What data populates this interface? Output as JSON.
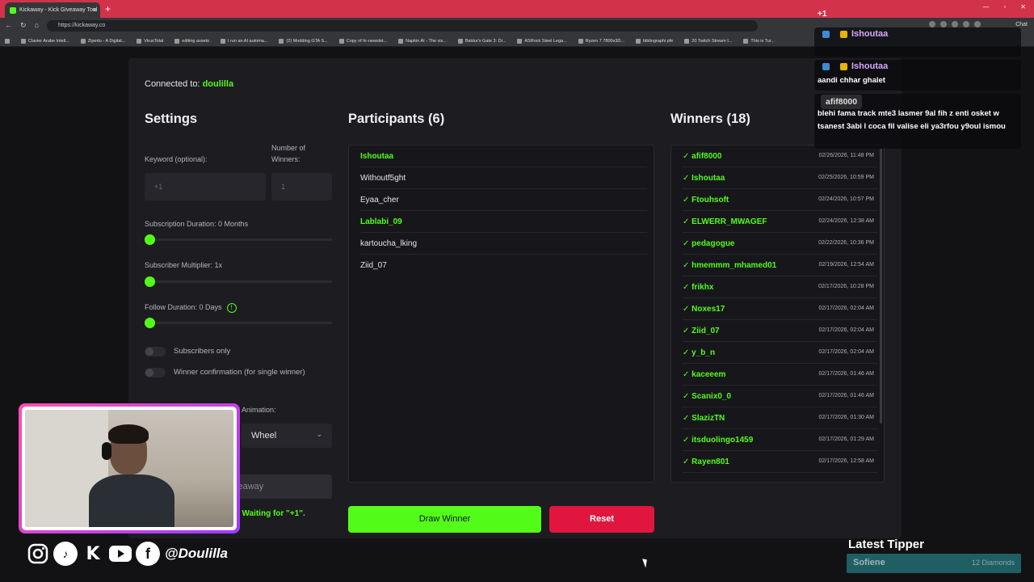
{
  "browser": {
    "tab_title": "Kickaway - Kick Giveaway Tool",
    "url": "https://kickaway.co",
    "chat_label": "Chat",
    "bookmarks": [
      "Clavier Arabe Intell...",
      "Ziperto - A Digital...",
      "VirusTotal",
      "editing assets",
      "I run an AI automa...",
      "(2) Modding GTA S...",
      "Copy of hr-newslet...",
      "Napkin AI - The vis...",
      "Baldur's Gate 3: Di...",
      "ASRock Steel Lega...",
      "Ryzen 7 7800x3D...",
      "bibliographi pfe",
      "20 Twitch Stream I...",
      "This is Tur..."
    ]
  },
  "app": {
    "connected_prefix": "Connected to:",
    "channel": "doulilla",
    "settings": {
      "title": "Settings",
      "keyword_label": "Keyword (optional):",
      "keyword_placeholder": "+1",
      "winners_label": "Number of Winners:",
      "winners_placeholder": "1",
      "sub_duration_label": "Subscription Duration: 0 Months",
      "sub_multiplier_label": "Subscriber Multiplier: 1x",
      "follow_duration_label": "Follow Duration: 0 Days",
      "info_glyph": "!",
      "subscribers_only_label": "Subscribers only",
      "winner_confirm_label": "Winner confirmation (for single winner)",
      "animation_label": "Animation:",
      "animation_value": "Wheel",
      "start_button_partial": "veaway",
      "status_text": "t! Waiting for \"+1\"."
    },
    "participants": {
      "title": "Participants (6)",
      "items": [
        {
          "name": "Ishoutaa",
          "highlight": true
        },
        {
          "name": "Withoutf5ght",
          "highlight": false
        },
        {
          "name": "Eyaa_cher",
          "highlight": false
        },
        {
          "name": "Lablabi_09",
          "highlight": true
        },
        {
          "name": "kartoucha_lking",
          "highlight": false
        },
        {
          "name": "Ziid_07",
          "highlight": false
        }
      ]
    },
    "winners": {
      "title": "Winners (18)",
      "items": [
        {
          "name": "✓ afif8000",
          "date": "02/26/2026, 11:48 PM"
        },
        {
          "name": "✓ Ishoutaa",
          "date": "02/25/2026, 10:59 PM"
        },
        {
          "name": "✓ Ftouhsoft",
          "date": "02/24/2026, 10:57 PM"
        },
        {
          "name": "✓ ELWERR_MWAGEF",
          "date": "02/24/2026, 12:38 AM"
        },
        {
          "name": "✓ pedagogue",
          "date": "02/22/2026, 10:36 PM"
        },
        {
          "name": "✓ hmemmm_mhamed01",
          "date": "02/19/2026, 12:54 AM"
        },
        {
          "name": "✓ frikhx",
          "date": "02/17/2026, 10:28 PM"
        },
        {
          "name": "✓ Noxes17",
          "date": "02/17/2026, 02:04 AM"
        },
        {
          "name": "✓ Ziid_07",
          "date": "02/17/2026, 02:04 AM"
        },
        {
          "name": "✓ y_b_n",
          "date": "02/17/2026, 02:04 AM"
        },
        {
          "name": "✓ kaceeem",
          "date": "02/17/2026, 01:46 AM"
        },
        {
          "name": "✓ Scanix0_0",
          "date": "02/17/2026, 01:46 AM"
        },
        {
          "name": "✓ SlazizTN",
          "date": "02/17/2026, 01:30 AM"
        },
        {
          "name": "✓ itsduolingo1459",
          "date": "02/17/2026, 01:29 AM"
        },
        {
          "name": "✓ Rayen801",
          "date": "02/17/2026, 12:58 AM"
        }
      ]
    },
    "draw_button": "Draw Winner",
    "reset_button": "Reset"
  },
  "chat": {
    "plus_text": "+1",
    "messages": [
      {
        "user": "Ishoutaa",
        "text": ""
      },
      {
        "user": "Ishoutaa",
        "text": "aandi chhar ghalet"
      },
      {
        "user": "afif8000",
        "text": "blehi fama track mte3 lasmer 9al fih z enti osket w tsanest 3abi l coca fil valise eli ya3rfou y9oul ismou"
      }
    ]
  },
  "overlay": {
    "social_handle": "@Doulilla",
    "latest_tipper_label": "Latest Tipper",
    "tipper_name": "Sofiene",
    "tipper_amount": "12 Diamonds"
  },
  "colors": {
    "accent": "#53fc18",
    "reset": "#e0163f",
    "titlebar": "#d3324b"
  }
}
